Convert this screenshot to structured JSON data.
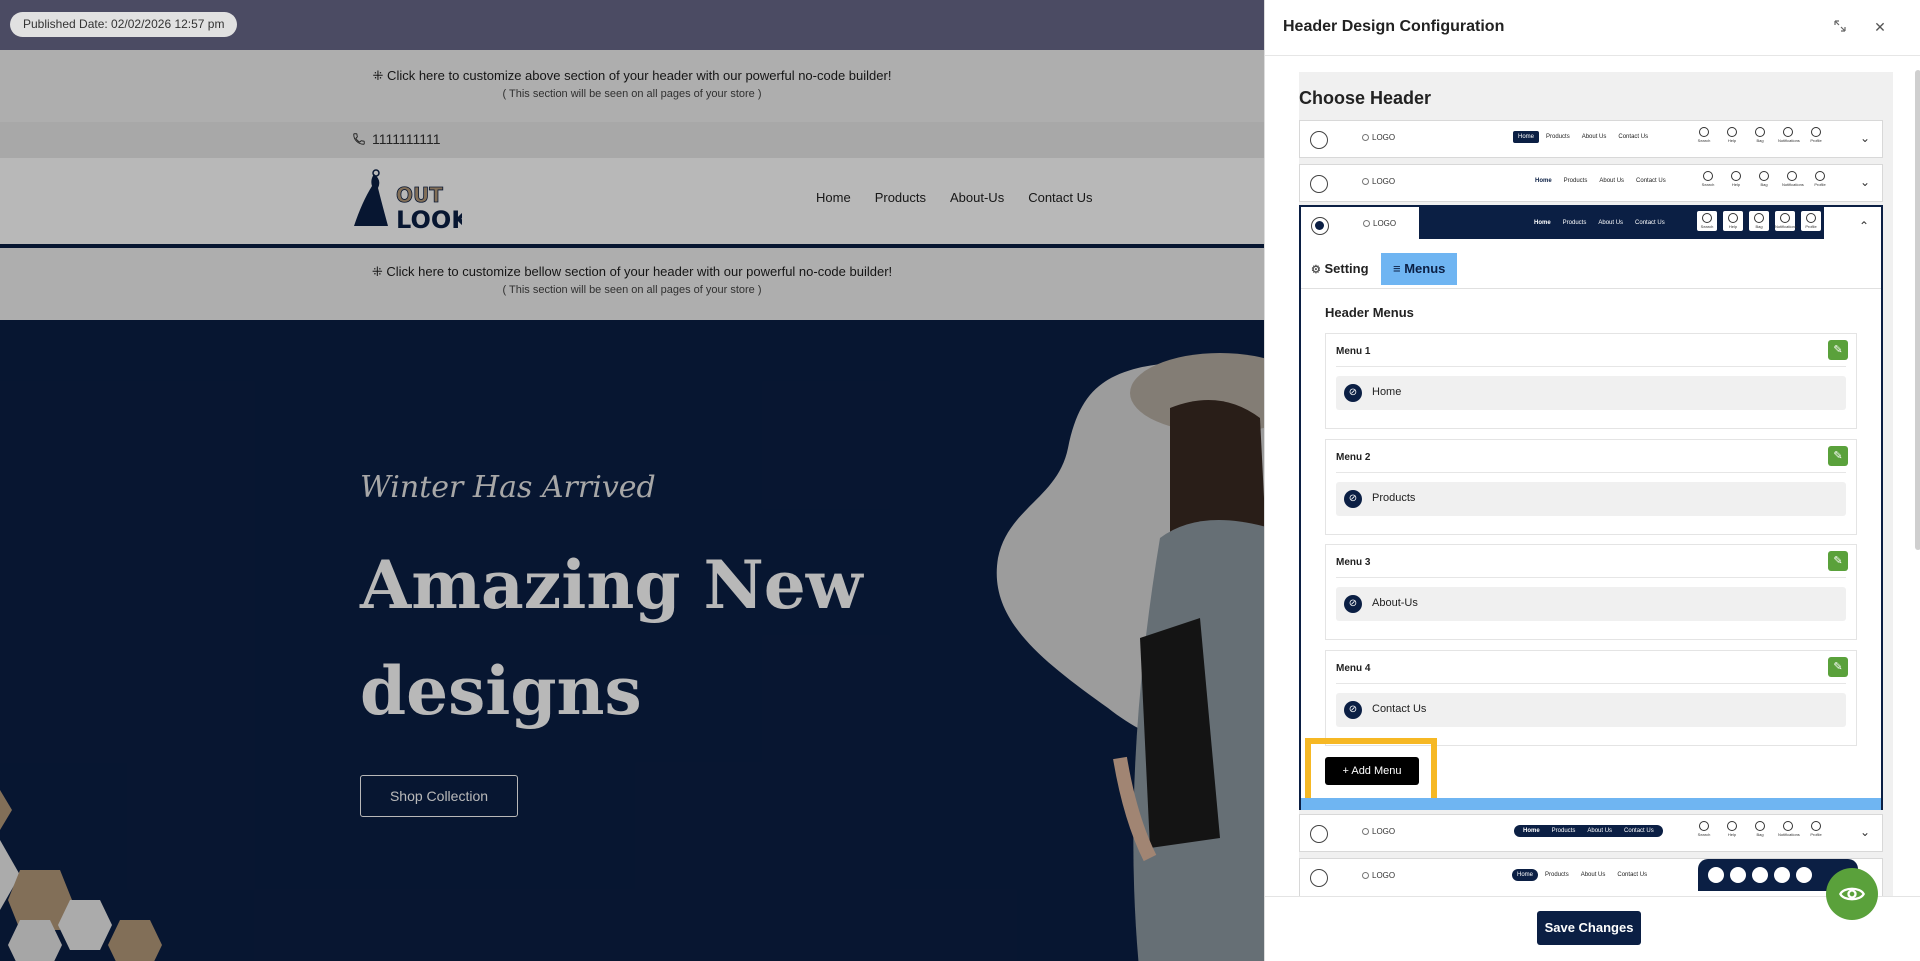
{
  "published_label": "Published Date: 02/02/2026 12:57 pm",
  "store": {
    "cta_above": {
      "line1": "⁜ Click here to customize above section of your header with our powerful no-code builder!",
      "line2": "( This section will be seen on all pages of your store )"
    },
    "phone": "1111111111",
    "logo_text": "OUT LOOK",
    "nav": [
      "Home",
      "Products",
      "About-Us",
      "Contact Us"
    ],
    "cta_below": {
      "line1": "⁜ Click here to customize bellow section of your header with our powerful no-code builder!",
      "line2": "( This section will be seen on all pages of your store )"
    },
    "hero": {
      "tagline": "Winter Has Arrived",
      "headline": "Amazing New designs",
      "cta": "Shop Collection"
    }
  },
  "panel": {
    "title": "Header Design Configuration",
    "expand_icon": "expand-icon",
    "close_icon": "close-icon",
    "choose_header": "Choose Header",
    "mini_logo": "LOGO",
    "mini_menu": [
      "Home",
      "Products",
      "About Us",
      "Contact Us"
    ],
    "mini_icons": [
      "Search",
      "Help",
      "Bag",
      "Notifications",
      "Profile"
    ],
    "tabs": {
      "setting": "Setting",
      "menus": "Menus"
    },
    "header_menus_title": "Header Menus",
    "menus": [
      {
        "title": "Menu 1",
        "item": "Home"
      },
      {
        "title": "Menu 2",
        "item": "Products"
      },
      {
        "title": "Menu 3",
        "item": "About-Us"
      },
      {
        "title": "Menu 4",
        "item": "Contact Us"
      }
    ],
    "add_menu": "+ Add Menu",
    "save": "Save Changes"
  },
  "colors": {
    "navy": "#0b1f44",
    "accent_blue": "#6fb5f2",
    "edit_green": "#5aa13b",
    "highlight": "#f6b824"
  }
}
